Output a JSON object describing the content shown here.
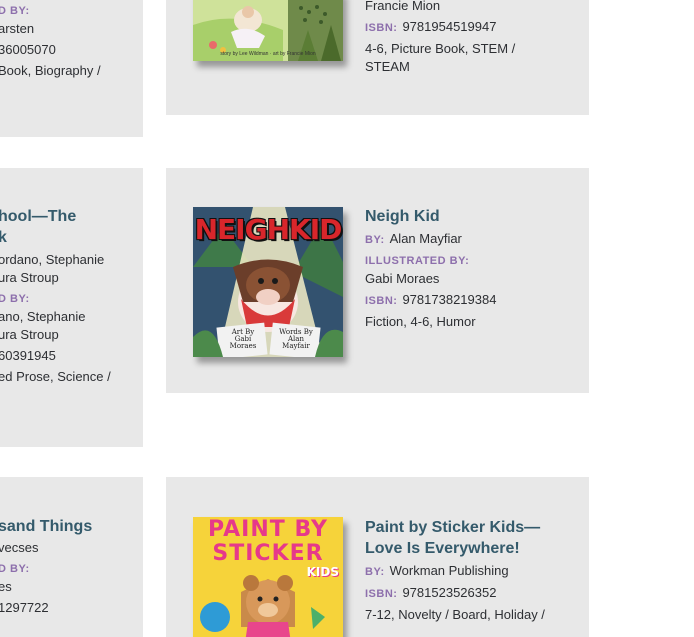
{
  "left_cards": [
    {
      "lines": [
        {
          "kind": "label",
          "text": "D BY:"
        },
        {
          "kind": "text",
          "text": "arsten"
        },
        {
          "kind": "text",
          "text": "36005070"
        },
        {
          "kind": "text",
          "text": "Book, Biography /"
        }
      ]
    },
    {
      "lines": [
        {
          "kind": "title",
          "text": "hool—The"
        },
        {
          "kind": "title",
          "text": "k"
        },
        {
          "kind": "text",
          "text": "ordano, Stephanie"
        },
        {
          "kind": "text",
          "text": "ura Stroup"
        },
        {
          "kind": "label",
          "text": "D BY:"
        },
        {
          "kind": "text",
          "text": "ano, Stephanie"
        },
        {
          "kind": "text",
          "text": "ura Stroup"
        },
        {
          "kind": "text",
          "text": "60391945"
        },
        {
          "kind": "text",
          "text": "ed Prose, Science /"
        }
      ]
    },
    {
      "lines": [
        {
          "kind": "title",
          "text": "sand Things"
        },
        {
          "kind": "text",
          "text": "vecses"
        },
        {
          "kind": "label",
          "text": "D BY:"
        },
        {
          "kind": "text",
          "text": "es"
        },
        {
          "kind": "text",
          "text": "1297722"
        }
      ]
    }
  ],
  "book1": {
    "illustrator": "Francie Mion",
    "isbn_label": "ISBN:",
    "isbn": "9781954519947",
    "categories_line1": "4-6, Picture Book, STEM /",
    "categories_line2": "STEAM",
    "cover_caption": "story by Lee Wildman · art by Francie Mion"
  },
  "book2": {
    "title": "Neigh Kid",
    "by_label": "BY:",
    "author": "Alan Mayfiar",
    "illustrated_label": "ILLUSTRATED BY:",
    "illustrator": "Gabi Moraes",
    "isbn_label": "ISBN:",
    "isbn": "9781738219384",
    "categories": "Fiction, 4-6, Humor",
    "cover_title": "NEIGHKID",
    "cover_art_by": "Art By",
    "cover_art_name1": "Gabi",
    "cover_art_name2": "Moraes",
    "cover_words_by": "Words By",
    "cover_words_name1": "Alan",
    "cover_words_name2": "Mayfair"
  },
  "book3": {
    "title_line1": "Paint by Sticker Kids—",
    "title_line2": "Love Is Everywhere!",
    "by_label": "BY:",
    "author": "Workman Publishing",
    "isbn_label": "ISBN:",
    "isbn": "9781523526352",
    "categories": "7-12, Novelty / Board, Holiday /",
    "cover_line1": "PAINT BY",
    "cover_line2": "STICKER",
    "cover_kids": "KIDS"
  },
  "colors": {
    "card_bg": "#e8e8e8",
    "title": "#345a6b",
    "label": "#8d6fac",
    "text": "#2d2f33"
  }
}
